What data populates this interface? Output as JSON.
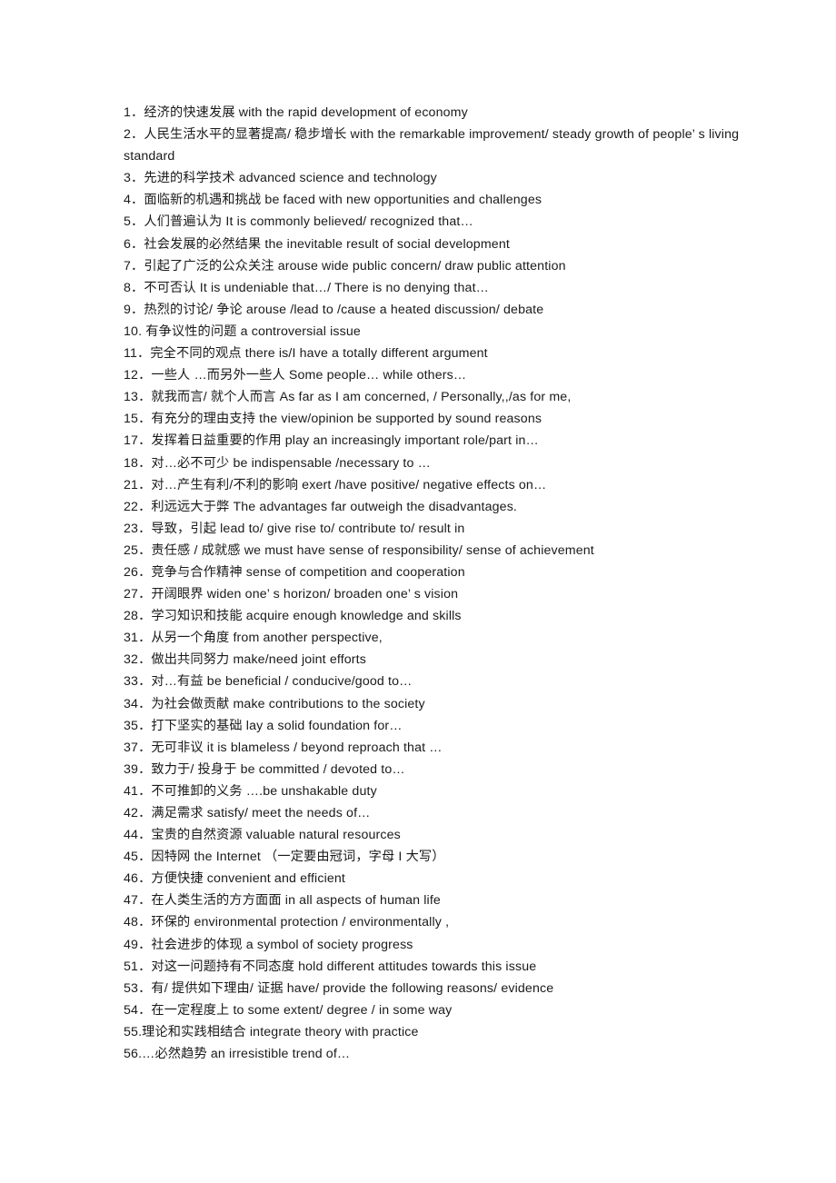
{
  "document": {
    "type": "phrase-reference-list",
    "background_color": "#ffffff",
    "text_color": "#1a1a1a",
    "entries": [
      {
        "number": "1．",
        "text": "1．经济的快速发展  with the rapid development of economy"
      },
      {
        "number": "2．",
        "text": "2．人民生活水平的显著提高/ 稳步增长    with the remarkable improvement/ steady growth of people’ s living standard"
      },
      {
        "number": "3．",
        "text": "3．先进的科学技术  advanced science and technology"
      },
      {
        "number": "4．",
        "text": "4．面临新的机遇和挑战  be faced with new opportunities and challenges"
      },
      {
        "number": "5．",
        "text": "5．人们普遍认为  It is commonly believed/ recognized that…"
      },
      {
        "number": "6．",
        "text": "6．社会发展的必然结果  the inevitable result of social development"
      },
      {
        "number": "7．",
        "text": "7．引起了广泛的公众关注  arouse wide public concern/ draw public attention"
      },
      {
        "number": "8．",
        "text": "8．不可否认  It is undeniable that…/ There is no denying that…"
      },
      {
        "number": "9．",
        "text": "9．热烈的讨论/ 争论  arouse /lead to /cause a heated discussion/ debate"
      },
      {
        "number": "10.",
        "text": "10. 有争议性的问题  a controversial issue"
      },
      {
        "number": "11．",
        "text": "11．完全不同的观点 there is/I have a totally different argument"
      },
      {
        "number": "12．",
        "text": "12．一些人 …而另外一些人 Some people…  while others…"
      },
      {
        "number": "13．",
        "text": "13．就我而言/ 就个人而言  As far as I am concerned, / Personally,,/as for me,"
      },
      {
        "number": "15．",
        "text": "15．有充分的理由支持  the view/opinion be supported by sound reasons"
      },
      {
        "number": "17．",
        "text": "17．发挥着日益重要的作用  play an increasingly important role/part in…"
      },
      {
        "number": "18．",
        "text": "18．对…必不可少  be indispensable /necessary to  …"
      },
      {
        "number": "21．",
        "text": "21．对…产生有利/不利的影响  exert /have positive/ negative effects on…"
      },
      {
        "number": "22．",
        "text": "22．利远远大于弊  The advantages far outweigh the disadvantages."
      },
      {
        "number": "23．",
        "text": "23．导致，引起  lead to/ give rise to/ contribute to/ result in"
      },
      {
        "number": "25．",
        "text": "25．责任感 / 成就感  we must have sense of responsibility/ sense of achievement"
      },
      {
        "number": "26．",
        "text": "26．竞争与合作精神  sense of competition and cooperation"
      },
      {
        "number": "27．",
        "text": "27．开阔眼界  widen one’ s horizon/ broaden one’ s vision"
      },
      {
        "number": "28．",
        "text": "28．学习知识和技能  acquire enough knowledge and skills"
      },
      {
        "number": "31．",
        "text": "31．从另一个角度  from another perspective,"
      },
      {
        "number": "32．",
        "text": "32．做出共同努力  make/need joint efforts"
      },
      {
        "number": "33．",
        "text": "33．对…有益  be beneficial / conducive/good to…"
      },
      {
        "number": "34．",
        "text": "34．为社会做贡献  make contributions to the society"
      },
      {
        "number": "35．",
        "text": "35．打下坚实的基础  lay a solid foundation for…"
      },
      {
        "number": "37．",
        "text": "37．无可非议  it is blameless / beyond reproach that  …"
      },
      {
        "number": "39．",
        "text": "39．致力于/ 投身于  be committed / devoted to…"
      },
      {
        "number": "41．",
        "text": "41．不可推卸的义务  ….be unshakable duty"
      },
      {
        "number": "42．",
        "text": "42．满足需求  satisfy/ meet the needs of…"
      },
      {
        "number": "44．",
        "text": "44．宝贵的自然资源  valuable natural resources"
      },
      {
        "number": "45．",
        "text": "45．因特网  the Internet  （一定要由冠词，字母 I 大写）"
      },
      {
        "number": "46．",
        "text": "46．方便快捷  convenient and efficient"
      },
      {
        "number": "47．",
        "text": "47．在人类生活的方方面面  in all aspects of human life"
      },
      {
        "number": "48．",
        "text": "48．环保的  environmental protection / environmentally ,"
      },
      {
        "number": "49．",
        "text": "49．社会进步的体现  a symbol of society progress"
      },
      {
        "number": "51．",
        "text": "51．对这一问题持有不同态度  hold different attitudes towards this issue"
      },
      {
        "number": "53．",
        "text": "53．有/ 提供如下理由/ 证据  have/ provide the following reasons/ evidence"
      },
      {
        "number": "54．",
        "text": "54．在一定程度上  to some extent/ degree / in some way"
      },
      {
        "number": "55．",
        "text": "55.理论和实践相结合  integrate theory with practice"
      },
      {
        "number": "56．",
        "text": "56.…必然趋势  an irresistible trend of…"
      }
    ]
  }
}
